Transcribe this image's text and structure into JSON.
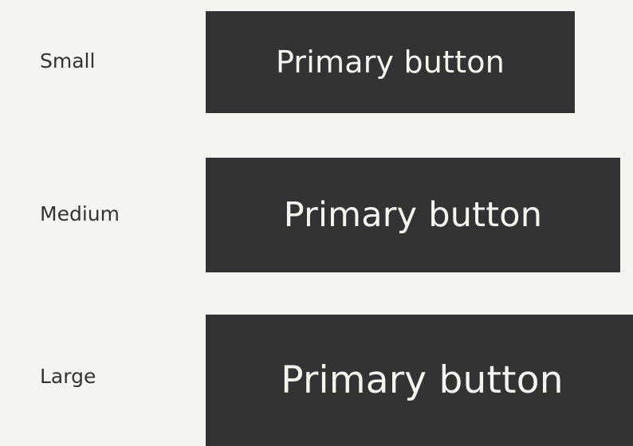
{
  "colors": {
    "background": "#f4f5f1",
    "button_background": "#333333",
    "button_text": "#f4f5f1",
    "label_text": "#333333"
  },
  "rows": [
    {
      "size_label": "Small",
      "button_label": "Primary button"
    },
    {
      "size_label": "Medium",
      "button_label": "Primary button"
    },
    {
      "size_label": "Large",
      "button_label": "Primary button"
    }
  ]
}
